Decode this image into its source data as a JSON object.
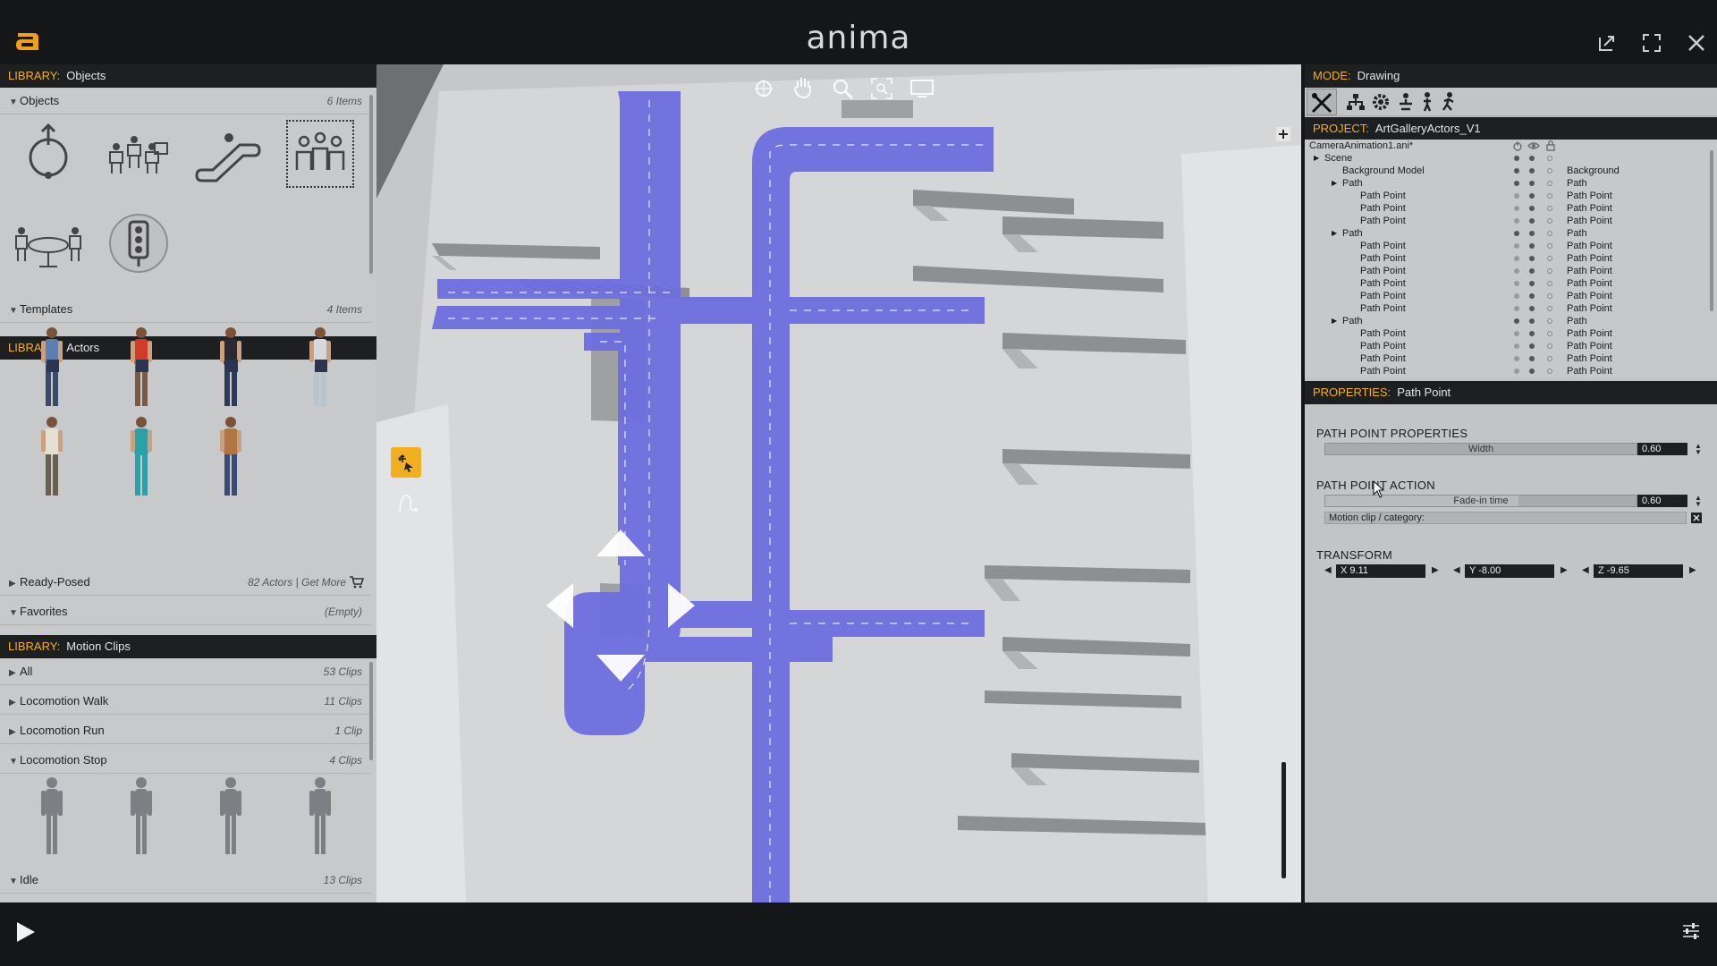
{
  "app": {
    "brand": "anima"
  },
  "left_panel": {
    "objects_header": {
      "key": "LIBRARY:",
      "value": "Objects"
    },
    "objects_section": {
      "label": "Objects",
      "count": "6 Items"
    },
    "object_icons": [
      "rotate-path-icon",
      "crowd-seats-icon",
      "escalator-icon",
      "group-crowd-icon",
      "table-seats-icon",
      "traffic-light-icon"
    ],
    "templates_section": {
      "label": "Templates",
      "count": "4 Items"
    },
    "actors_header": {
      "key": "LIBRARY:",
      "value": "Actors"
    },
    "ready_posed": {
      "label": "Ready-Posed",
      "count": "82 Actors | Get More"
    },
    "favorites": {
      "label": "Favorites",
      "count": "(Empty)"
    },
    "motion_header": {
      "key": "LIBRARY:",
      "value": "Motion Clips"
    },
    "motion_sections": [
      {
        "label": "All",
        "count": "53 Clips"
      },
      {
        "label": "Locomotion Walk",
        "count": "11 Clips"
      },
      {
        "label": "Locomotion Run",
        "count": "1 Clip"
      },
      {
        "label": "Locomotion Stop",
        "count": "4 Clips"
      },
      {
        "label": "Idle",
        "count": "13 Clips"
      }
    ]
  },
  "right_panel": {
    "mode": {
      "key": "MODE:",
      "value": "Drawing"
    },
    "project": {
      "key": "PROJECT:",
      "value": "ArtGalleryActors_V1"
    },
    "tree": {
      "file": "CameraAnimation1.ani*",
      "rows": [
        {
          "name": "Scene",
          "type": ""
        },
        {
          "name": "Background Model",
          "type": "Background"
        },
        {
          "name": "Path",
          "type": "Path"
        },
        {
          "name": "Path Point",
          "type": "Path Point"
        },
        {
          "name": "Path Point",
          "type": "Path Point"
        },
        {
          "name": "Path Point",
          "type": "Path Point"
        },
        {
          "name": "Path",
          "type": "Path"
        },
        {
          "name": "Path Point",
          "type": "Path Point"
        },
        {
          "name": "Path Point",
          "type": "Path Point"
        },
        {
          "name": "Path Point",
          "type": "Path Point"
        },
        {
          "name": "Path Point",
          "type": "Path Point"
        },
        {
          "name": "Path Point",
          "type": "Path Point"
        },
        {
          "name": "Path Point",
          "type": "Path Point"
        },
        {
          "name": "Path",
          "type": "Path"
        },
        {
          "name": "Path Point",
          "type": "Path Point"
        },
        {
          "name": "Path Point",
          "type": "Path Point"
        },
        {
          "name": "Path Point",
          "type": "Path Point"
        },
        {
          "name": "Path Point",
          "type": "Path Point"
        }
      ]
    },
    "properties": {
      "key": "PROPERTIES:",
      "value": "Path Point"
    },
    "path_point_properties": {
      "title": "PATH POINT PROPERTIES",
      "width_label": "Width",
      "width_value": "0.60"
    },
    "path_point_action": {
      "title": "PATH POINT ACTION",
      "fade_label": "Fade-in time",
      "fade_value": "0.60",
      "fade_fill": 0.62,
      "motion_clip_label": "Motion clip / category:"
    },
    "transform": {
      "title": "TRANSFORM",
      "x": "X 9.11",
      "y": "Y -8.00",
      "z": "Z -9.65"
    }
  }
}
